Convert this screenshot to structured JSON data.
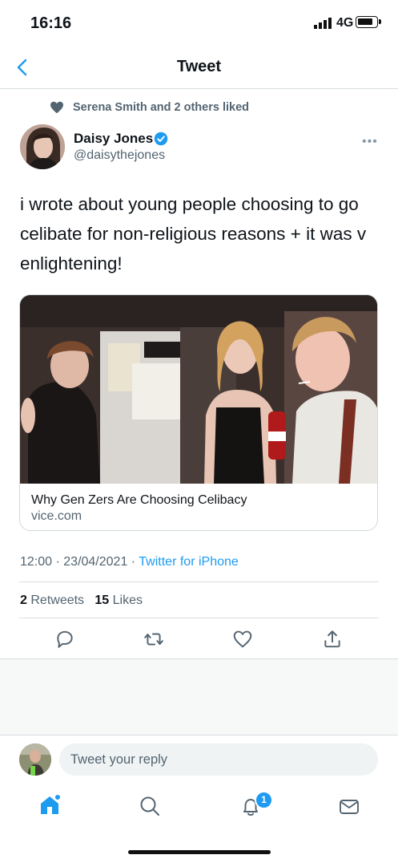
{
  "status_bar": {
    "time": "16:16",
    "network": "4G"
  },
  "header": {
    "title": "Tweet"
  },
  "social_context": {
    "text": "Serena Smith and 2 others liked"
  },
  "author": {
    "name": "Daisy Jones",
    "handle": "@daisythejones",
    "more": "•••"
  },
  "tweet": {
    "text": "i wrote about young people choosing to go celibate for non-religious reasons + it was v enlightening!",
    "time": "12:00",
    "date": "23/04/2021",
    "source": "Twitter for iPhone"
  },
  "card": {
    "title": "Why Gen Zers Are Choosing Celibacy",
    "domain": "vice.com"
  },
  "stats": {
    "retweets_count": "2",
    "retweets_label": "Retweets",
    "likes_count": "15",
    "likes_label": "Likes"
  },
  "reply": {
    "placeholder": "Tweet your reply"
  },
  "tab_bar": {
    "notifications_badge": "1"
  },
  "colors": {
    "accent": "#1d9bf0",
    "secondary_text": "#536471",
    "divider": "#cfd9de"
  }
}
